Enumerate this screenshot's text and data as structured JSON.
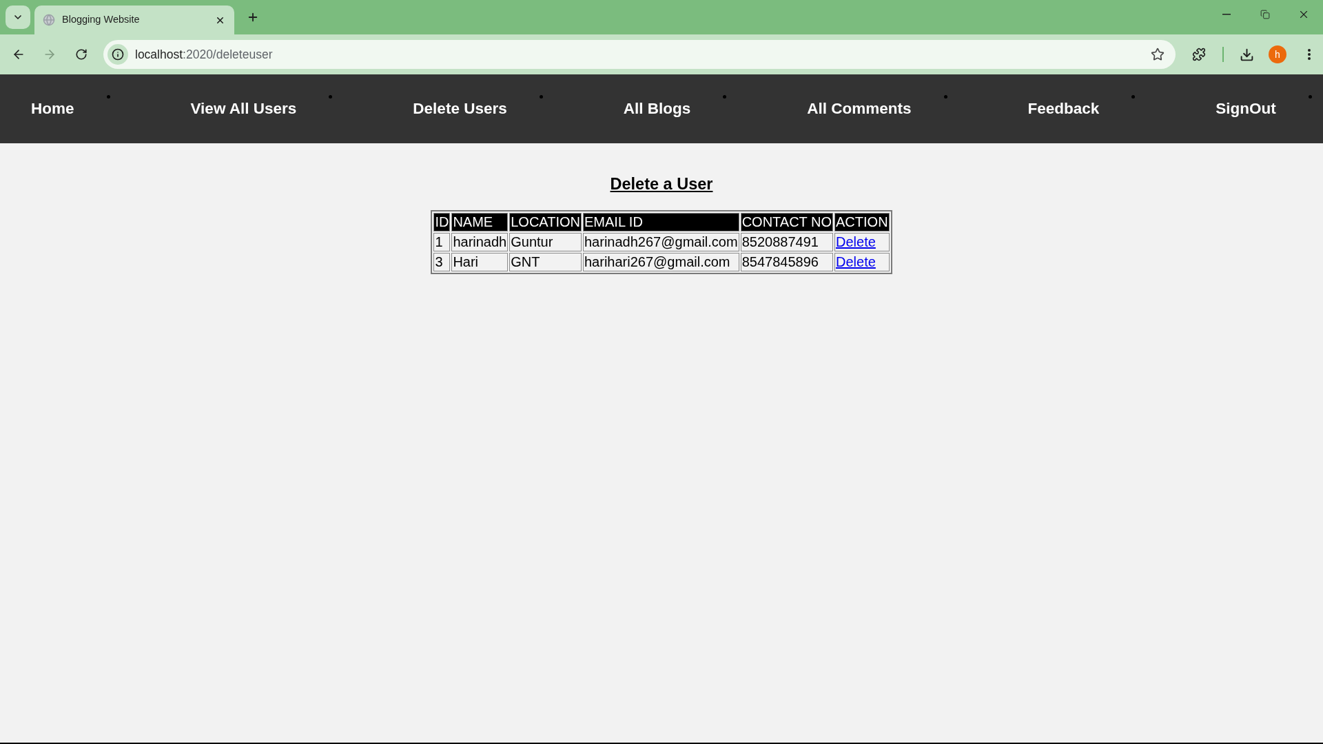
{
  "browser": {
    "tabs": [
      {
        "title": "Blogging Website",
        "selected": true
      }
    ],
    "toolbar": {
      "forward": {
        "disabled": true
      }
    },
    "address": {
      "host": "localhost",
      "rest": ":2020/deleteuser"
    },
    "profile": {
      "initial": "h"
    }
  },
  "nav": {
    "items": [
      {
        "label": "Home"
      },
      {
        "label": "View All Users"
      },
      {
        "label": "Delete Users"
      },
      {
        "label": "All Blogs"
      },
      {
        "label": "All Comments"
      },
      {
        "label": "Feedback"
      },
      {
        "label": "SignOut"
      }
    ]
  },
  "page": {
    "title": "Delete a User"
  },
  "table": {
    "columns": [
      "ID",
      "NAME",
      "LOCATION",
      "EMAIL ID",
      "CONTACT NO",
      "ACTION"
    ],
    "rows": [
      {
        "cells": [
          "1",
          "harinadh",
          "Guntur",
          "harinadh267@gmail.com",
          "8520887491"
        ],
        "action": "Delete"
      },
      {
        "cells": [
          "3",
          "Hari",
          "GNT",
          "harihari267@gmail.com",
          "8547845896"
        ],
        "action": "Delete"
      }
    ]
  }
}
